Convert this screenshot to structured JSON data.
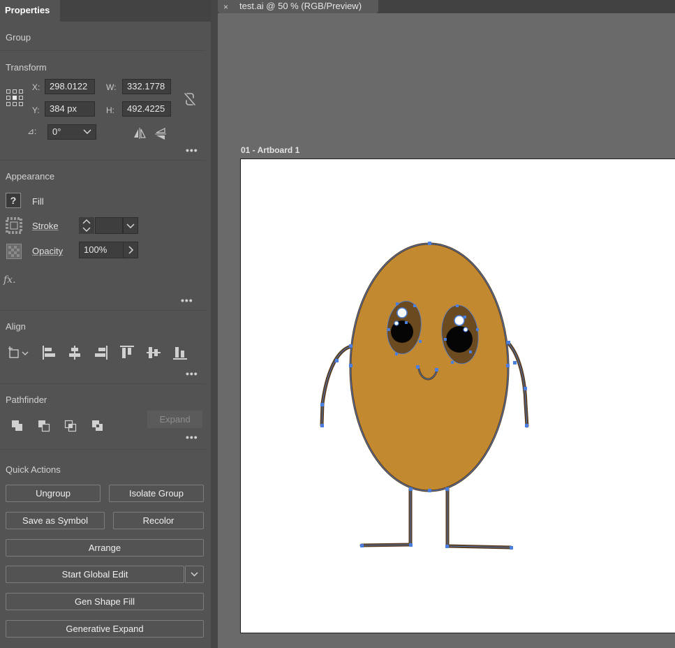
{
  "panel": {
    "tab_label": "Properties",
    "selection_type": "Group"
  },
  "transform": {
    "title": "Transform",
    "x_label": "X:",
    "x_value": "298.0122",
    "y_label": "Y:",
    "y_value": "384 px",
    "w_label": "W:",
    "w_value": "332.1778",
    "h_label": "H:",
    "h_value": "492.4225",
    "rotate_label": "⊿:",
    "rotate_value": "0°",
    "more": "•••"
  },
  "appearance": {
    "title": "Appearance",
    "fill_label": "Fill",
    "fill_swatch": "?",
    "stroke_label": "Stroke",
    "stroke_value": "",
    "opacity_label": "Opacity",
    "opacity_value": "100%",
    "fx_label": "fx.",
    "more": "•••"
  },
  "align": {
    "title": "Align",
    "more": "•••"
  },
  "pathfinder": {
    "title": "Pathfinder",
    "expand_label": "Expand",
    "more": "•••"
  },
  "quick_actions": {
    "title": "Quick Actions",
    "ungroup": "Ungroup",
    "isolate_group": "Isolate Group",
    "save_as_symbol": "Save as Symbol",
    "recolor": "Recolor",
    "arrange": "Arrange",
    "start_global_edit": "Start Global Edit",
    "gen_shape_fill": "Gen Shape Fill",
    "generative_expand": "Generative Expand"
  },
  "document": {
    "tab_title": "test.ai @ 50 % (RGB/Preview)",
    "close_glyph": "×",
    "artboard_label": "01 - Artboard 1"
  },
  "colors": {
    "panel_bg": "#535353",
    "canvas_bg": "#6a6a6a",
    "body_fill": "#c38930",
    "stroke_brown": "#5a4125",
    "selection_blue": "#4a7fe0"
  }
}
